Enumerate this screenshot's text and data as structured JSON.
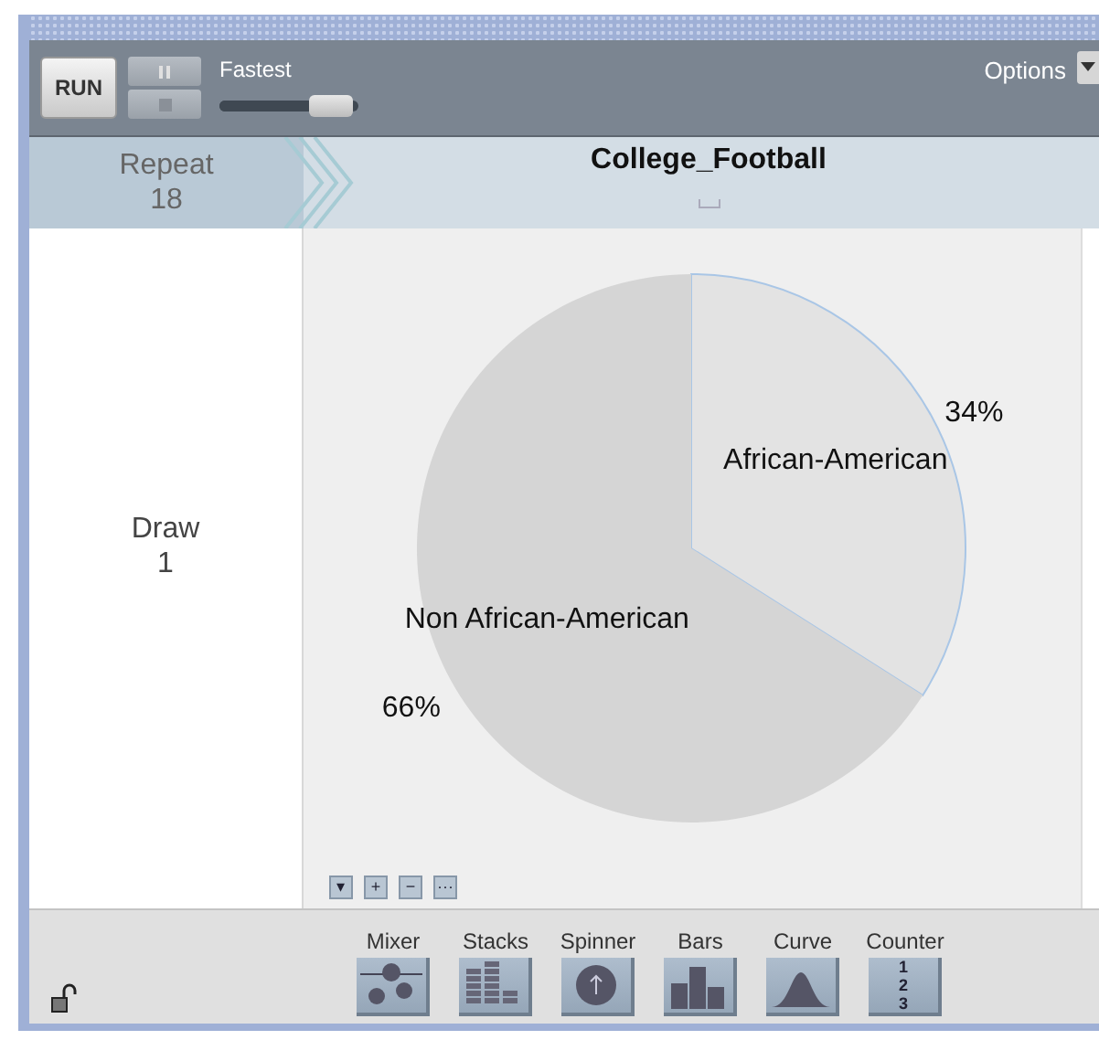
{
  "toolbar": {
    "run_label": "RUN",
    "speed_label": "Fastest",
    "speed": {
      "level": 0.85
    },
    "options_label": "Options"
  },
  "header": {
    "repeat_label": "Repeat",
    "repeat_count": "18",
    "title": "College_Football"
  },
  "left_panel": {
    "draw_label": "Draw",
    "draw_count": "1"
  },
  "chart": {
    "chart_data": {
      "type": "pie",
      "categories": [
        "African-American",
        "Non African-American"
      ],
      "values": [
        34,
        66
      ],
      "value_labels": [
        "34%",
        "66%"
      ]
    }
  },
  "zoom_buttons": [
    "▾",
    "+",
    "−",
    "···"
  ],
  "devices": [
    {
      "kind": "mixer",
      "label": "Mixer"
    },
    {
      "kind": "stacks",
      "label": "Stacks"
    },
    {
      "kind": "spinner",
      "label": "Spinner"
    },
    {
      "kind": "bars",
      "label": "Bars"
    },
    {
      "kind": "curve",
      "label": "Curve"
    },
    {
      "kind": "counter",
      "label": "Counter",
      "digits": [
        "1",
        "2",
        "3"
      ]
    }
  ]
}
